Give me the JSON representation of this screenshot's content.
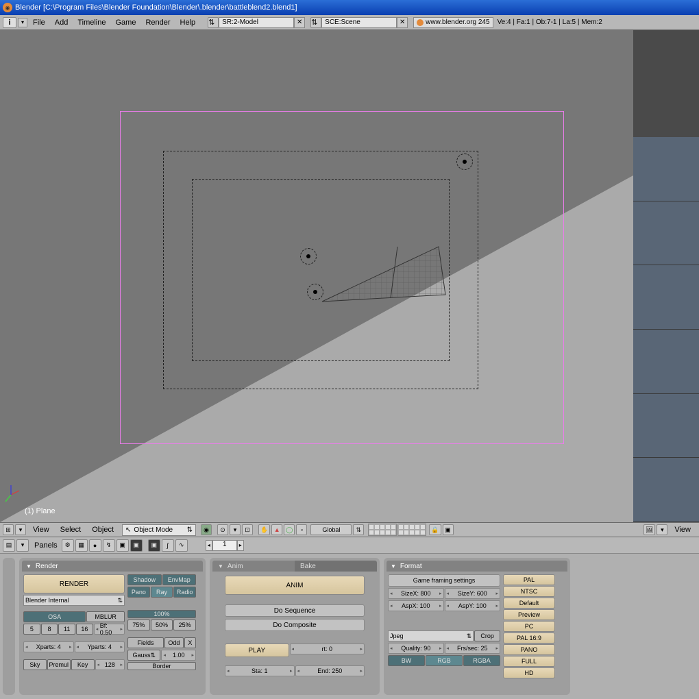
{
  "titlebar": {
    "app": "Blender",
    "file": "[C:\\Program Files\\Blender Foundation\\Blender\\.blender\\battleblend2.blend1]"
  },
  "menubar": {
    "items": [
      "File",
      "Add",
      "Timeline",
      "Game",
      "Render",
      "Help"
    ],
    "screen_selector": "SR:2-Model",
    "scene_selector": "SCE:Scene",
    "link": "www.blender.org 245",
    "stats": "Ve:4 | Fa:1 | Ob:7-1 | La:5 | Mem:2"
  },
  "viewport": {
    "object_label": "(1) Plane"
  },
  "view_toolbar": {
    "menus": [
      "View",
      "Select",
      "Object"
    ],
    "mode": "Object Mode",
    "orientation": "Global",
    "right_menu": "View"
  },
  "panels_toolbar": {
    "label": "Panels",
    "frame": "1"
  },
  "render_panel": {
    "title": "Render",
    "render_btn": "RENDER",
    "engine": "Blender Internal",
    "shadow": "Shadow",
    "envmap": "EnvMap",
    "pano": "Pano",
    "ray": "Ray",
    "radio": "Radio",
    "osa": "OSA",
    "mblur": "MBLUR",
    "osa_vals": [
      "5",
      "8",
      "11",
      "16"
    ],
    "bf": "Bf: 0.50",
    "pct100": "100%",
    "pcts": [
      "75%",
      "50%",
      "25%"
    ],
    "xparts": "Xparts: 4",
    "yparts": "Yparts: 4",
    "fields": "Fields",
    "odd": "Odd",
    "x": "X",
    "sky": "Sky",
    "premul": "Premul",
    "key": "Key",
    "v128": "128",
    "gauss": "Gauss",
    "gauss_v": "1.00",
    "border": "Border"
  },
  "anim_panel": {
    "tabs": [
      "Anim",
      "Bake"
    ],
    "anim_btn": "ANIM",
    "do_seq": "Do Sequence",
    "do_comp": "Do Composite",
    "play": "PLAY",
    "rt": "rt: 0",
    "sta": "Sta: 1",
    "end": "End: 250"
  },
  "format_panel": {
    "title": "Format",
    "game_framing": "Game framing settings",
    "sizex": "SizeX: 800",
    "sizey": "SizeY: 600",
    "aspx": "AspX: 100",
    "aspy": "AspY: 100",
    "format": "Jpeg",
    "crop": "Crop",
    "quality": "Quality: 90",
    "fps": "Frs/sec: 25",
    "bw": "BW",
    "rgb": "RGB",
    "rgba": "RGBA",
    "presets": [
      "PAL",
      "NTSC",
      "Default",
      "Preview",
      "PC",
      "PAL 16:9",
      "PANO",
      "FULL",
      "HD"
    ]
  }
}
